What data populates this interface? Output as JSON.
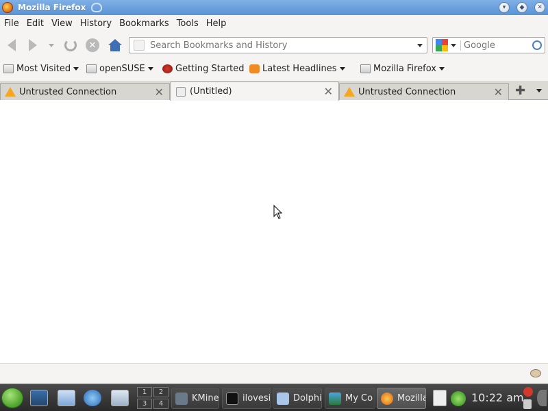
{
  "window": {
    "title": "Mozilla Firefox",
    "buttons": [
      "minimize",
      "maximize",
      "close"
    ]
  },
  "menubar": {
    "items": [
      "File",
      "Edit",
      "View",
      "History",
      "Bookmarks",
      "Tools",
      "Help"
    ]
  },
  "navbar": {
    "url_placeholder": "Search Bookmarks and History",
    "search_placeholder": "Google",
    "search_engine_icon": "google-icon"
  },
  "bookmarks": {
    "items": [
      {
        "label": "Most Visited",
        "icon": "folder-icon",
        "dropdown": true
      },
      {
        "label": "openSUSE",
        "icon": "folder-icon",
        "dropdown": true
      },
      {
        "label": "Getting Started",
        "icon": "firefox-icon",
        "dropdown": false
      },
      {
        "label": "Latest Headlines",
        "icon": "rss-icon",
        "dropdown": true
      },
      {
        "label": "Mozilla Firefox",
        "icon": "folder-icon",
        "dropdown": true
      }
    ]
  },
  "tabs": [
    {
      "label": "Untrusted Connection",
      "icon": "warning-icon",
      "active": false
    },
    {
      "label": "(Untitled)",
      "icon": "blank-page-icon",
      "active": true
    },
    {
      "label": "Untrusted Connection",
      "icon": "warning-icon",
      "active": false
    }
  ],
  "taskbar": {
    "pager": [
      "1",
      "2",
      "3",
      "4"
    ],
    "tasks": [
      {
        "label": "KMine",
        "icon": "kmines-icon"
      },
      {
        "label": "ilovesi",
        "icon": "terminal-icon"
      },
      {
        "label": "Dolphi",
        "icon": "dolphin-icon"
      },
      {
        "label": "My Co",
        "icon": "my-computer-icon"
      },
      {
        "label": "Mozilla",
        "icon": "firefox-icon"
      }
    ],
    "clock": "10:22 am"
  },
  "colors": {
    "titlebar": "#6aa0dc",
    "chrome": "#f5f4f2",
    "taskbar": "#333333",
    "warning": "#f5a623"
  }
}
